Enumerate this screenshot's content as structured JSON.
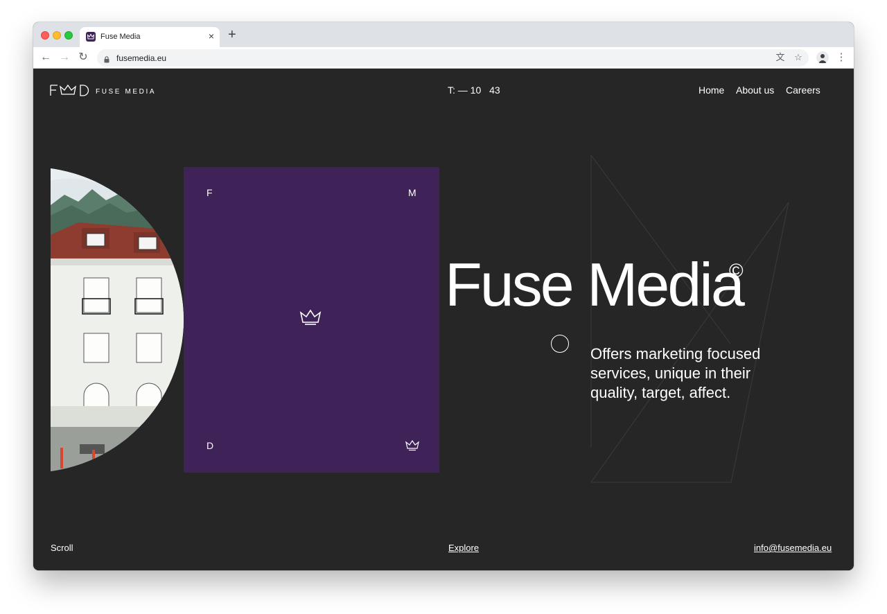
{
  "browser": {
    "tab_title": "Fuse Media",
    "tab_close": "×",
    "new_tab": "+",
    "url": "fusemedia.eu",
    "back": "←",
    "forward": "→",
    "reload": "↻",
    "translate": "文",
    "bookmark": "☆",
    "menu": "⋮"
  },
  "header": {
    "logo_text": "FUSE MEDIA",
    "clock_prefix": "T: —",
    "clock_hour": "10",
    "clock_minute": "43",
    "nav": [
      "Home",
      "About us",
      "Careers"
    ]
  },
  "card": {
    "top_left": "F",
    "top_right": "M",
    "bottom_left": "D",
    "color": "#3f2258"
  },
  "hero": {
    "title": "Fuse Media",
    "copyright": "©",
    "tagline": "Offers marketing focused services, unique in their quality, target, affect."
  },
  "footer": {
    "scroll": "Scroll",
    "explore": "Explore",
    "email": "info@fusemedia.eu"
  },
  "colors": {
    "page_bg": "#262626",
    "accent": "#3f2258"
  }
}
